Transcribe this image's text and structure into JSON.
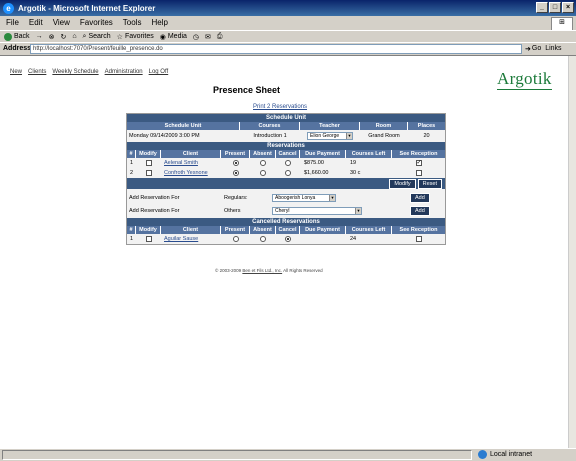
{
  "window": {
    "title": "Argotik - Microsoft Internet Explorer",
    "minimize": "_",
    "maximize": "□",
    "close": "×"
  },
  "menu": [
    "File",
    "Edit",
    "View",
    "Favorites",
    "Tools",
    "Help"
  ],
  "toolbar": {
    "back": "Back",
    "search": "Search",
    "favorites": "Favorites",
    "media": "Media"
  },
  "address": {
    "label": "Address",
    "url": "http://localhost:7070/Present/feuille_presence.do",
    "go": "Go",
    "links": "Links"
  },
  "nav": [
    "New",
    "Clients",
    "Weekly Schedule",
    "Administration",
    "Log Off"
  ],
  "logo": "Argotik",
  "page": {
    "title": "Presence Sheet",
    "print_link": "Print 2 Reservations"
  },
  "schedule": {
    "section": "Schedule Unit",
    "headers": [
      "Schedule Unit",
      "Courses",
      "Teacher",
      "Room",
      "Places"
    ],
    "unit": "Monday 09/14/2009 3:00 PM",
    "course": "Introduction 1",
    "teacher": "Elion George",
    "room": "Grand Room",
    "places": "20"
  },
  "reservations": {
    "section": "Reservations",
    "headers": [
      "#",
      "Modify",
      "Client",
      "Present",
      "Absent",
      "Cancel",
      "Due Payment",
      "Courses Left",
      "See Reception"
    ],
    "rows": [
      {
        "num": "1",
        "client": "Aelenal Smith",
        "due": "$875.00",
        "left": "19",
        "present": true,
        "reception": true
      },
      {
        "num": "2",
        "client": "Confroth Yesnone",
        "due": "$1,660.00",
        "left": "30 c",
        "present": true,
        "reception": false
      }
    ],
    "modify_btn": "Modify",
    "reset_btn": "Reset"
  },
  "add_reservation": {
    "label": "Add Reservation For",
    "regulars_label": "Regulars:",
    "regulars_value": "Aboogerish Lonya",
    "others_label": "Others",
    "others_value": "Cheryl",
    "add_btn": "Add"
  },
  "cancelled": {
    "section": "Cancelled Reservations",
    "headers": [
      "#",
      "Modify",
      "Client",
      "Present",
      "Absent",
      "Cancel",
      "Due Payment",
      "Courses Left",
      "See Reception"
    ],
    "rows": [
      {
        "num": "1",
        "client": "Aguilar Sause",
        "due": "",
        "left": "24"
      }
    ]
  },
  "footer": {
    "prefix": "© 2003-2009",
    "link": "Ben et Fils Ltd., Inc.",
    "suffix": "All Rights Reserved"
  },
  "status": {
    "zone": "Local intranet"
  }
}
